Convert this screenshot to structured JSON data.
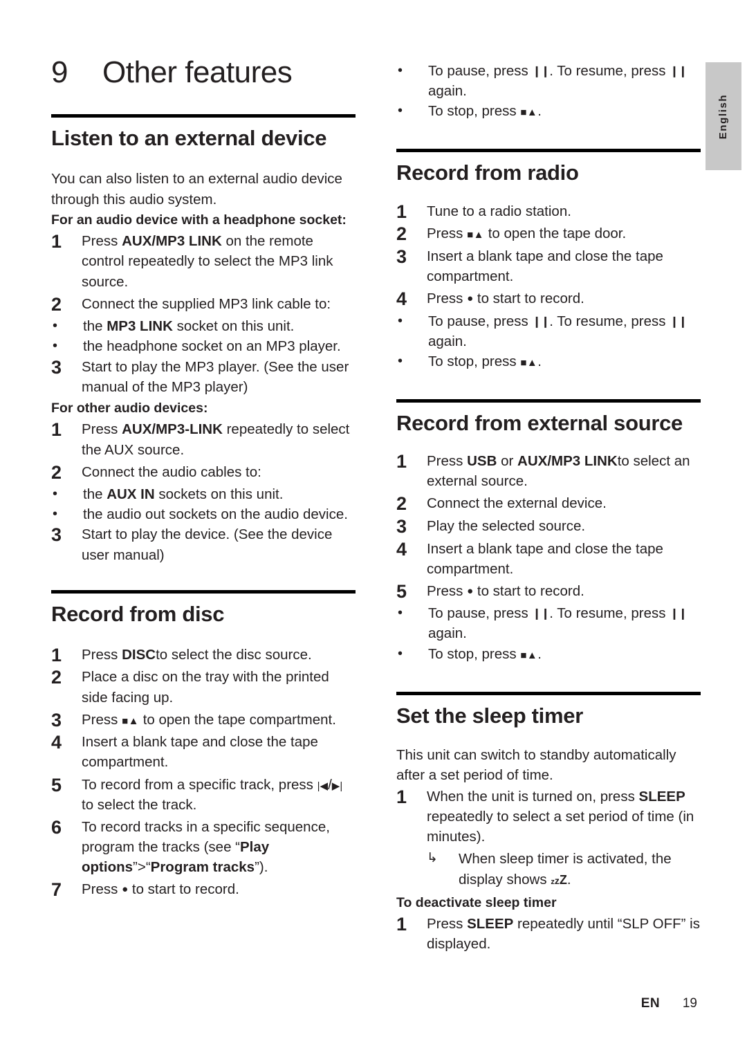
{
  "page": {
    "language_tab": "English",
    "footer_locale": "EN",
    "footer_page": "19"
  },
  "chapter": {
    "number": "9",
    "title": "Other features"
  },
  "glyphs": {
    "pause": "❙❙",
    "stop_eject": "■▲",
    "record": "●",
    "prev": "|◀",
    "next": "▶|",
    "arrow": "↳",
    "bullet": "•",
    "sleep_z": "zzZ"
  },
  "left_column": {
    "section_listen": {
      "heading": "Listen to an external device",
      "intro": "You can also listen to an external audio device through this audio system.",
      "subhead_headphone": "For an audio device with a headphone socket:",
      "headphone_steps": [
        {
          "n": "1",
          "pre": "Press ",
          "bold": "AUX/MP3 LINK",
          "post": " on the remote control repeatedly to select the MP3 link source."
        },
        {
          "n": "2",
          "pre": "Connect the supplied MP3 link cable to:",
          "bold": "",
          "post": ""
        }
      ],
      "headphone_bullets": [
        {
          "pre": "the ",
          "bold": "MP3 LINK",
          "post": " socket on this unit."
        },
        {
          "pre": "the headphone socket on an MP3 player.",
          "bold": "",
          "post": ""
        }
      ],
      "headphone_step3": {
        "n": "3",
        "pre": "Start to play the MP3 player. (See the user manual of the MP3 player)",
        "bold": "",
        "post": ""
      },
      "subhead_other": "For other audio devices:",
      "other_steps": [
        {
          "n": "1",
          "pre": "Press ",
          "bold": "AUX/MP3-LINK",
          "post": " repeatedly to select the AUX source."
        },
        {
          "n": "2",
          "pre": "Connect the audio cables to:",
          "bold": "",
          "post": ""
        }
      ],
      "other_bullets": [
        {
          "pre": "the ",
          "bold": "AUX IN",
          "post": " sockets on this unit."
        },
        {
          "pre": "the audio out sockets on the audio device.",
          "bold": "",
          "post": ""
        }
      ],
      "other_step3": {
        "n": "3",
        "pre": "Start to play the device. (See the device user manual)",
        "bold": "",
        "post": ""
      }
    },
    "section_record_disc": {
      "heading": "Record from disc",
      "steps": [
        {
          "n": "1",
          "pre": "Press ",
          "bold": "DISC",
          "post": "to select the disc source."
        },
        {
          "n": "2",
          "pre": "Place a disc on the tray with the printed side facing up."
        },
        {
          "n": "3",
          "pre": "Press ",
          "glyph": "stop_eject",
          "post": " to open the tape compartment."
        },
        {
          "n": "4",
          "pre": "Insert a blank tape and close the tape compartment."
        },
        {
          "n": "5",
          "pre": "To record from a specific track, press ",
          "glyph": "prev_next",
          "post": " to select the track."
        },
        {
          "n": "6",
          "pre": "To record tracks in a specific sequence, program the tracks (see “",
          "bold": "Play options",
          "mid": "”>“",
          "bold2": "Program tracks",
          "post": "”)."
        },
        {
          "n": "7",
          "pre": "Press ",
          "glyph": "record",
          "post": " to start to record."
        }
      ]
    }
  },
  "right_column": {
    "top_bullets": [
      {
        "pre": "To pause, press ",
        "glyph": "pause",
        "mid": ". To resume, press ",
        "glyph2": "pause",
        "post": " again."
      },
      {
        "pre": "To stop, press ",
        "glyph": "stop_eject",
        "post": "."
      }
    ],
    "section_record_radio": {
      "heading": "Record from radio",
      "steps": [
        {
          "n": "1",
          "pre": "Tune to a radio station."
        },
        {
          "n": "2",
          "pre": "Press ",
          "glyph": "stop_eject",
          "post": " to open the tape door."
        },
        {
          "n": "3",
          "pre": "Insert a blank tape and close the tape compartment."
        },
        {
          "n": "4",
          "pre": "Press ",
          "glyph": "record",
          "post": " to start to record."
        }
      ],
      "bullets": [
        {
          "pre": "To pause, press ",
          "glyph": "pause",
          "mid": ". To resume, press ",
          "glyph2": "pause",
          "post": " again."
        },
        {
          "pre": "To stop, press ",
          "glyph": "stop_eject",
          "post": "."
        }
      ]
    },
    "section_record_external": {
      "heading": "Record from external source",
      "steps": [
        {
          "n": "1",
          "pre": "Press ",
          "bold": "USB",
          "mid": " or ",
          "bold2": "AUX/MP3 LINK",
          "post": "to select an external source."
        },
        {
          "n": "2",
          "pre": "Connect the external device."
        },
        {
          "n": "3",
          "pre": "Play the selected source."
        },
        {
          "n": "4",
          "pre": "Insert a blank tape and close the tape compartment."
        },
        {
          "n": "5",
          "pre": "Press ",
          "glyph": "record",
          "post": " to start to record."
        }
      ],
      "bullets": [
        {
          "pre": "To pause, press ",
          "glyph": "pause",
          "mid": ". To resume, press ",
          "glyph2": "pause",
          "post": " again."
        },
        {
          "pre": "To stop, press ",
          "glyph": "stop_eject",
          "post": "."
        }
      ]
    },
    "section_sleep": {
      "heading": "Set the sleep timer",
      "intro": "This unit can switch to standby automatically after a set period of time.",
      "step1": {
        "n": "1",
        "pre": "When the unit is turned on, press ",
        "bold": "SLEEP",
        "post": " repeatedly to select a set period of time (in minutes)."
      },
      "note": {
        "pre": "When sleep timer is activated, the display shows ",
        "post": "."
      },
      "subhead_deactivate": "To deactivate sleep timer",
      "deactivate_step": {
        "n": "1",
        "pre": "Press ",
        "bold": "SLEEP",
        "post": " repeatedly until “SLP OFF” is displayed."
      }
    }
  }
}
